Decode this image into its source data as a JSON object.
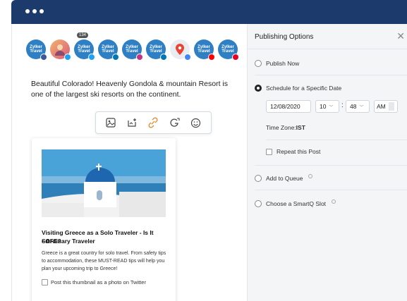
{
  "avatars": [
    {
      "text": "Zylker Travel",
      "badge_color": "#3b5998",
      "kind": "brand"
    },
    {
      "text": "",
      "badge_color": "#1da1f2",
      "kind": "photo"
    },
    {
      "text": "Zylker Travel",
      "badge_color": "#1da1f2",
      "kind": "brand"
    },
    {
      "text": "Zylker Travel",
      "badge_color": "#0077b5",
      "kind": "brand"
    },
    {
      "text": "Zylker Travel",
      "badge_color": "#c13584",
      "kind": "brand"
    },
    {
      "text": "Zylker Travel",
      "badge_color": "#0077b5",
      "kind": "brand"
    },
    {
      "text": "",
      "badge_color": "#4285f4",
      "kind": "pin"
    },
    {
      "text": "Zylker Travel",
      "badge_color": "#ff0000",
      "kind": "brand"
    },
    {
      "text": "Zylker Travel",
      "badge_color": "#e60023",
      "kind": "brand"
    }
  ],
  "avatar_count": "134",
  "post_text": "Beautiful Colorado! Heavenly Gondola & mountain Resort is one of the largest ski resorts on the continent.",
  "card": {
    "title": "Visiting Greece as a Solo Traveler - Is It SAFE?",
    "subtitle": "• Ordinary Traveler",
    "description": "Greece is a great country for solo travel. From safety tips to accommodation, these MUST-READ tips will help you plan your upcoming trip to Greece!",
    "thumbnail_option": "Post this thumbnail as a photo on Twitter"
  },
  "panel": {
    "title": "Publishing Options",
    "publish_now": "Publish Now",
    "schedule": "Schedule for a Specific Date",
    "date": "12/08/2020",
    "hour": "10",
    "minute": "48",
    "ampm": "AM",
    "timezone_label": "Time Zone: ",
    "timezone_value": "IST",
    "repeat": "Repeat this Post",
    "queue": "Add to Queue",
    "smartq": "Choose a SmartQ Slot"
  }
}
